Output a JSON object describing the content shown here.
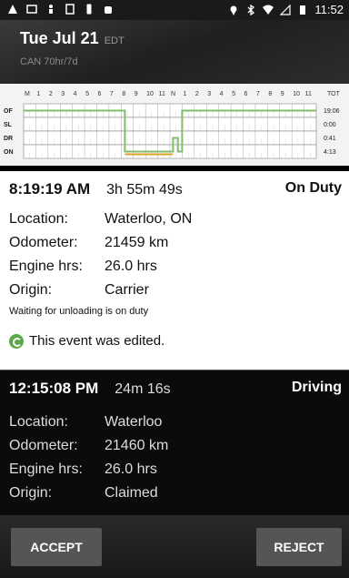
{
  "status_bar": {
    "time": "11:52",
    "icons_left": [
      "warning-icon",
      "image-icon",
      "person-icon",
      "sim-icon",
      "phone-icon",
      "android-icon"
    ],
    "icons_right": [
      "location-icon",
      "bluetooth-icon",
      "wifi-icon",
      "signal-icon",
      "battery-icon"
    ]
  },
  "header": {
    "date": "Tue Jul 21",
    "timezone": "EDT",
    "cycle": "CAN 70hr/7d"
  },
  "log_graph": {
    "hour_labels": [
      "M",
      "1",
      "2",
      "3",
      "4",
      "5",
      "6",
      "7",
      "8",
      "9",
      "10",
      "11",
      "N",
      "1",
      "2",
      "3",
      "4",
      "5",
      "6",
      "7",
      "8",
      "9",
      "10",
      "11"
    ],
    "total_label": "TOT",
    "rows": [
      {
        "label": "OF",
        "total": "19:06"
      },
      {
        "label": "SL",
        "total": "0:00"
      },
      {
        "label": "DR",
        "total": "0:41"
      },
      {
        "label": "ON",
        "total": "4:13"
      }
    ],
    "colors": {
      "trace": "#7fbf6a",
      "highlight": "#e0a030"
    }
  },
  "events": [
    {
      "time": "8:19:19 AM",
      "duration": "3h 55m 49s",
      "status": "On Duty",
      "location_label": "Location:",
      "location": "Waterloo, ON",
      "odometer_label": "Odometer:",
      "odometer": "21459 km",
      "engine_label": "Engine hrs:",
      "engine": "26.0 hrs",
      "origin_label": "Origin:",
      "origin": "Carrier",
      "note": "Waiting for unloading is on duty",
      "edited": "This event was edited."
    },
    {
      "time": "12:15:08 PM",
      "duration": "24m 16s",
      "status": "Driving",
      "location_label": "Location:",
      "location": "Waterloo",
      "odometer_label": "Odometer:",
      "odometer": "21460 km",
      "engine_label": "Engine hrs:",
      "engine": "26.0 hrs",
      "origin_label": "Origin:",
      "origin": "Claimed"
    }
  ],
  "actions": {
    "accept": "ACCEPT",
    "reject": "REJECT"
  }
}
